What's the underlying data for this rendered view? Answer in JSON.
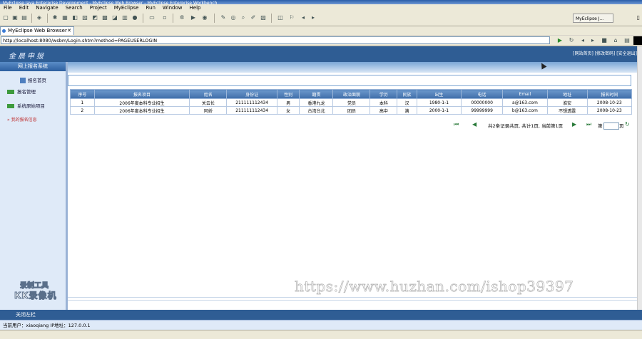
{
  "window": {
    "title": "MyEclipse Java Enterprise Development - MyEclipse Web Browser - MyEclipse Enterprise Workbench"
  },
  "menu": [
    "File",
    "Edit",
    "Navigate",
    "Search",
    "Project",
    "MyEclipse",
    "Run",
    "Window",
    "Help"
  ],
  "perspective": "MyEclipse J...",
  "editor_tab": "MyEclipse Web Browser",
  "url": "http://localhost:8080/wsbm/Login.shtm?method=PAGEUSERLOGIN",
  "app": {
    "logo": "金晨申报",
    "header_links": "[网站首页] [修改密码] [安全退出]",
    "system_title": "网上报名系统",
    "nav_home": "报名首页",
    "nav_items": [
      "报名管理",
      "系统原始项目"
    ],
    "nav_sub": "我的报名信息",
    "watermark_line1": "录制工具",
    "watermark_line2": "KK录像机",
    "footer": "关闭左栏",
    "status": "当前用户：xiaoqiang   IP地址：127.0.0.1"
  },
  "table": {
    "headers": [
      "序号",
      "报名项目",
      "姓名",
      "身份证",
      "性别",
      "籍贯",
      "政治面貌",
      "学历",
      "民族",
      "出生",
      "电话",
      "Email",
      "地址",
      "报名时间"
    ],
    "rows": [
      [
        "1",
        "2006年度本科专业招生",
        "关云长",
        "211111112434",
        "男",
        "香港九龙",
        "党员",
        "本科",
        "汉",
        "1980-1-1",
        "00000000",
        "a@163.com",
        "淮安",
        "2008-10-23"
      ],
      [
        "2",
        "2006年度本科专业招生",
        "阿娇",
        "211111112434",
        "女",
        "台湾台北",
        "团员",
        "高中",
        "满",
        "2000-1-1",
        "99999999",
        "b@163.com",
        "不想透露",
        "2008-10-23"
      ]
    ]
  },
  "pager": {
    "summary": "共2条记录共页, 共计1页, 当前第1页",
    "goto_label": "第",
    "goto_suffix": "页"
  },
  "overlay_watermark": "https://www.huzhan.com/ishop39397",
  "colors": {
    "header": "#2f5d94",
    "table_header": "#4f7fbb",
    "sidebar": "#dfeaf8"
  }
}
